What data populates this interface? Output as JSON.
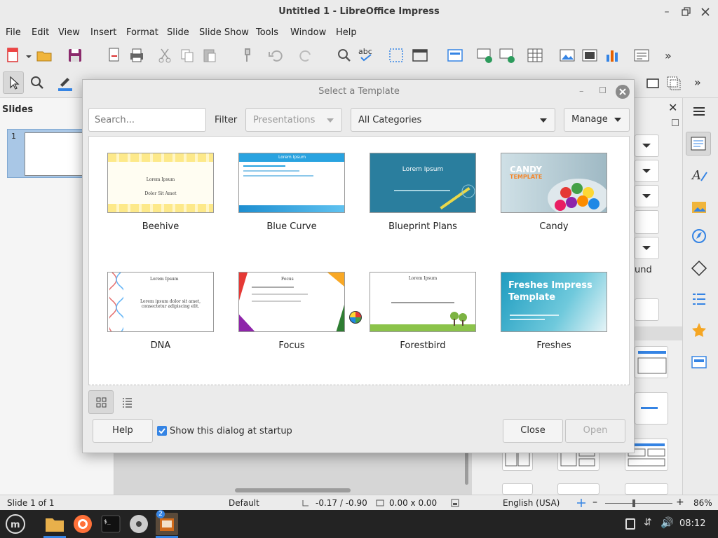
{
  "window": {
    "title": "Untitled 1 - LibreOffice Impress"
  },
  "menu": [
    "File",
    "Edit",
    "View",
    "Insert",
    "Format",
    "Slide",
    "Slide Show",
    "Tools",
    "Window",
    "Help"
  ],
  "slides_pane": {
    "title": "Slides",
    "slide_number": "1"
  },
  "sidebar": {
    "partial_text": "und"
  },
  "dialog": {
    "title": "Select a Template",
    "search_placeholder": "Search...",
    "filter_label": "Filter",
    "filter_value": "Presentations",
    "category_value": "All Categories",
    "manage_label": "Manage",
    "templates": [
      {
        "name": "Beehive",
        "title": "Lorem Ipsum",
        "subtitle": "Dolor Sit Amet"
      },
      {
        "name": "Blue Curve",
        "title": "Lorem Ipsum"
      },
      {
        "name": "Blueprint Plans",
        "title": "Lorem Ipsum"
      },
      {
        "name": "Candy",
        "title": "CANDY",
        "subtitle": "TEMPLATE"
      },
      {
        "name": "DNA",
        "title": "Lorem Ipsum",
        "subtitle": "Lorem ipsum dolor sit amet, consectetur adipiscing elit."
      },
      {
        "name": "Focus",
        "title": "Focus"
      },
      {
        "name": "Forestbird",
        "title": "Lorem Ipsum"
      },
      {
        "name": "Freshes",
        "title": "Freshes Impress Template"
      }
    ],
    "help_label": "Help",
    "startup_checkbox_label": "Show this dialog at startup",
    "startup_checked": true,
    "close_label": "Close",
    "open_label": "Open"
  },
  "statusbar": {
    "slide": "Slide 1 of 1",
    "layout": "Default",
    "position": "-0.17 / -0.90",
    "size": "0.00 x 0.00",
    "language": "English (USA)",
    "zoom": "86%"
  },
  "taskbar": {
    "clock": "08:12",
    "badge_count": "2"
  },
  "colors": {
    "accent": "#3584e4",
    "slide_selection": "#a9c7e6"
  }
}
